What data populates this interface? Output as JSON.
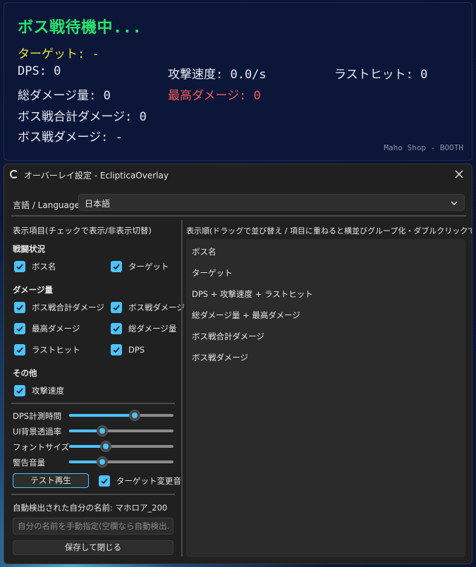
{
  "overlay": {
    "status": "ボス戦待機中...",
    "target": "ターゲット: -",
    "dps": "DPS: 0",
    "attack_speed": "攻撃速度: 0.0/s",
    "last_hit": "ラストヒット: 0",
    "total_damage": "総ダメージ量: 0",
    "max_damage": "最高ダメージ: 0",
    "boss_total_damage": "ボス戦合計ダメージ: 0",
    "boss_damage": "ボス戦ダメージ: -",
    "credit": "Maho Shop - BOOTH",
    "colors": {
      "status": "#27e36b",
      "target": "#e8e23a",
      "max_damage": "#ee5a5a"
    }
  },
  "window": {
    "title": "オーバーレイ設定 - EclipticaOverlay",
    "close_icon": "close-icon"
  },
  "language": {
    "label": "言語 / Language",
    "selected": "日本語"
  },
  "left": {
    "header": "表示項目(チェックで表示/非表示切替)",
    "groups": [
      {
        "title": "戦闘状況",
        "items": [
          {
            "label": "ボス名",
            "checked": true
          },
          {
            "label": "ターゲット",
            "checked": true
          }
        ]
      },
      {
        "title": "ダメージ量",
        "items": [
          {
            "label": "ボス戦合計ダメージ",
            "checked": true
          },
          {
            "label": "ボス戦ダメージ",
            "checked": true
          },
          {
            "label": "最高ダメージ",
            "checked": true
          },
          {
            "label": "総ダメージ量",
            "checked": true
          },
          {
            "label": "ラストヒット",
            "checked": true
          },
          {
            "label": "DPS",
            "checked": true
          }
        ]
      },
      {
        "title": "その他",
        "items": [
          {
            "label": "攻撃速度",
            "checked": true
          }
        ]
      }
    ],
    "sliders": [
      {
        "label": "DPS計測時間",
        "value": 0.63
      },
      {
        "label": "UI背景透過率",
        "value": 0.32
      },
      {
        "label": "フォントサイズ",
        "value": 0.35
      },
      {
        "label": "警告音量",
        "value": 0.32
      }
    ],
    "test_button": "テスト再生",
    "target_sound": {
      "label": "ターゲット変更音",
      "checked": true
    },
    "detected_name": "自動検出された自分の名前: マホロア_200",
    "name_placeholder": "自分の名前を手動指定(空欄なら自動検出...",
    "save_button": "保存して閉じる"
  },
  "right": {
    "header": "表示順(ドラッグで並び替え / 項目に重ねると横並びグループ化・ダブルクリックで解除)",
    "items": [
      "ボス名",
      "ターゲット",
      "DPS + 攻撃速度 + ラストヒット",
      "総ダメージ量 + 最高ダメージ",
      "ボス戦合計ダメージ",
      "ボス戦ダメージ"
    ]
  },
  "accent_color": "#4cc2ff"
}
